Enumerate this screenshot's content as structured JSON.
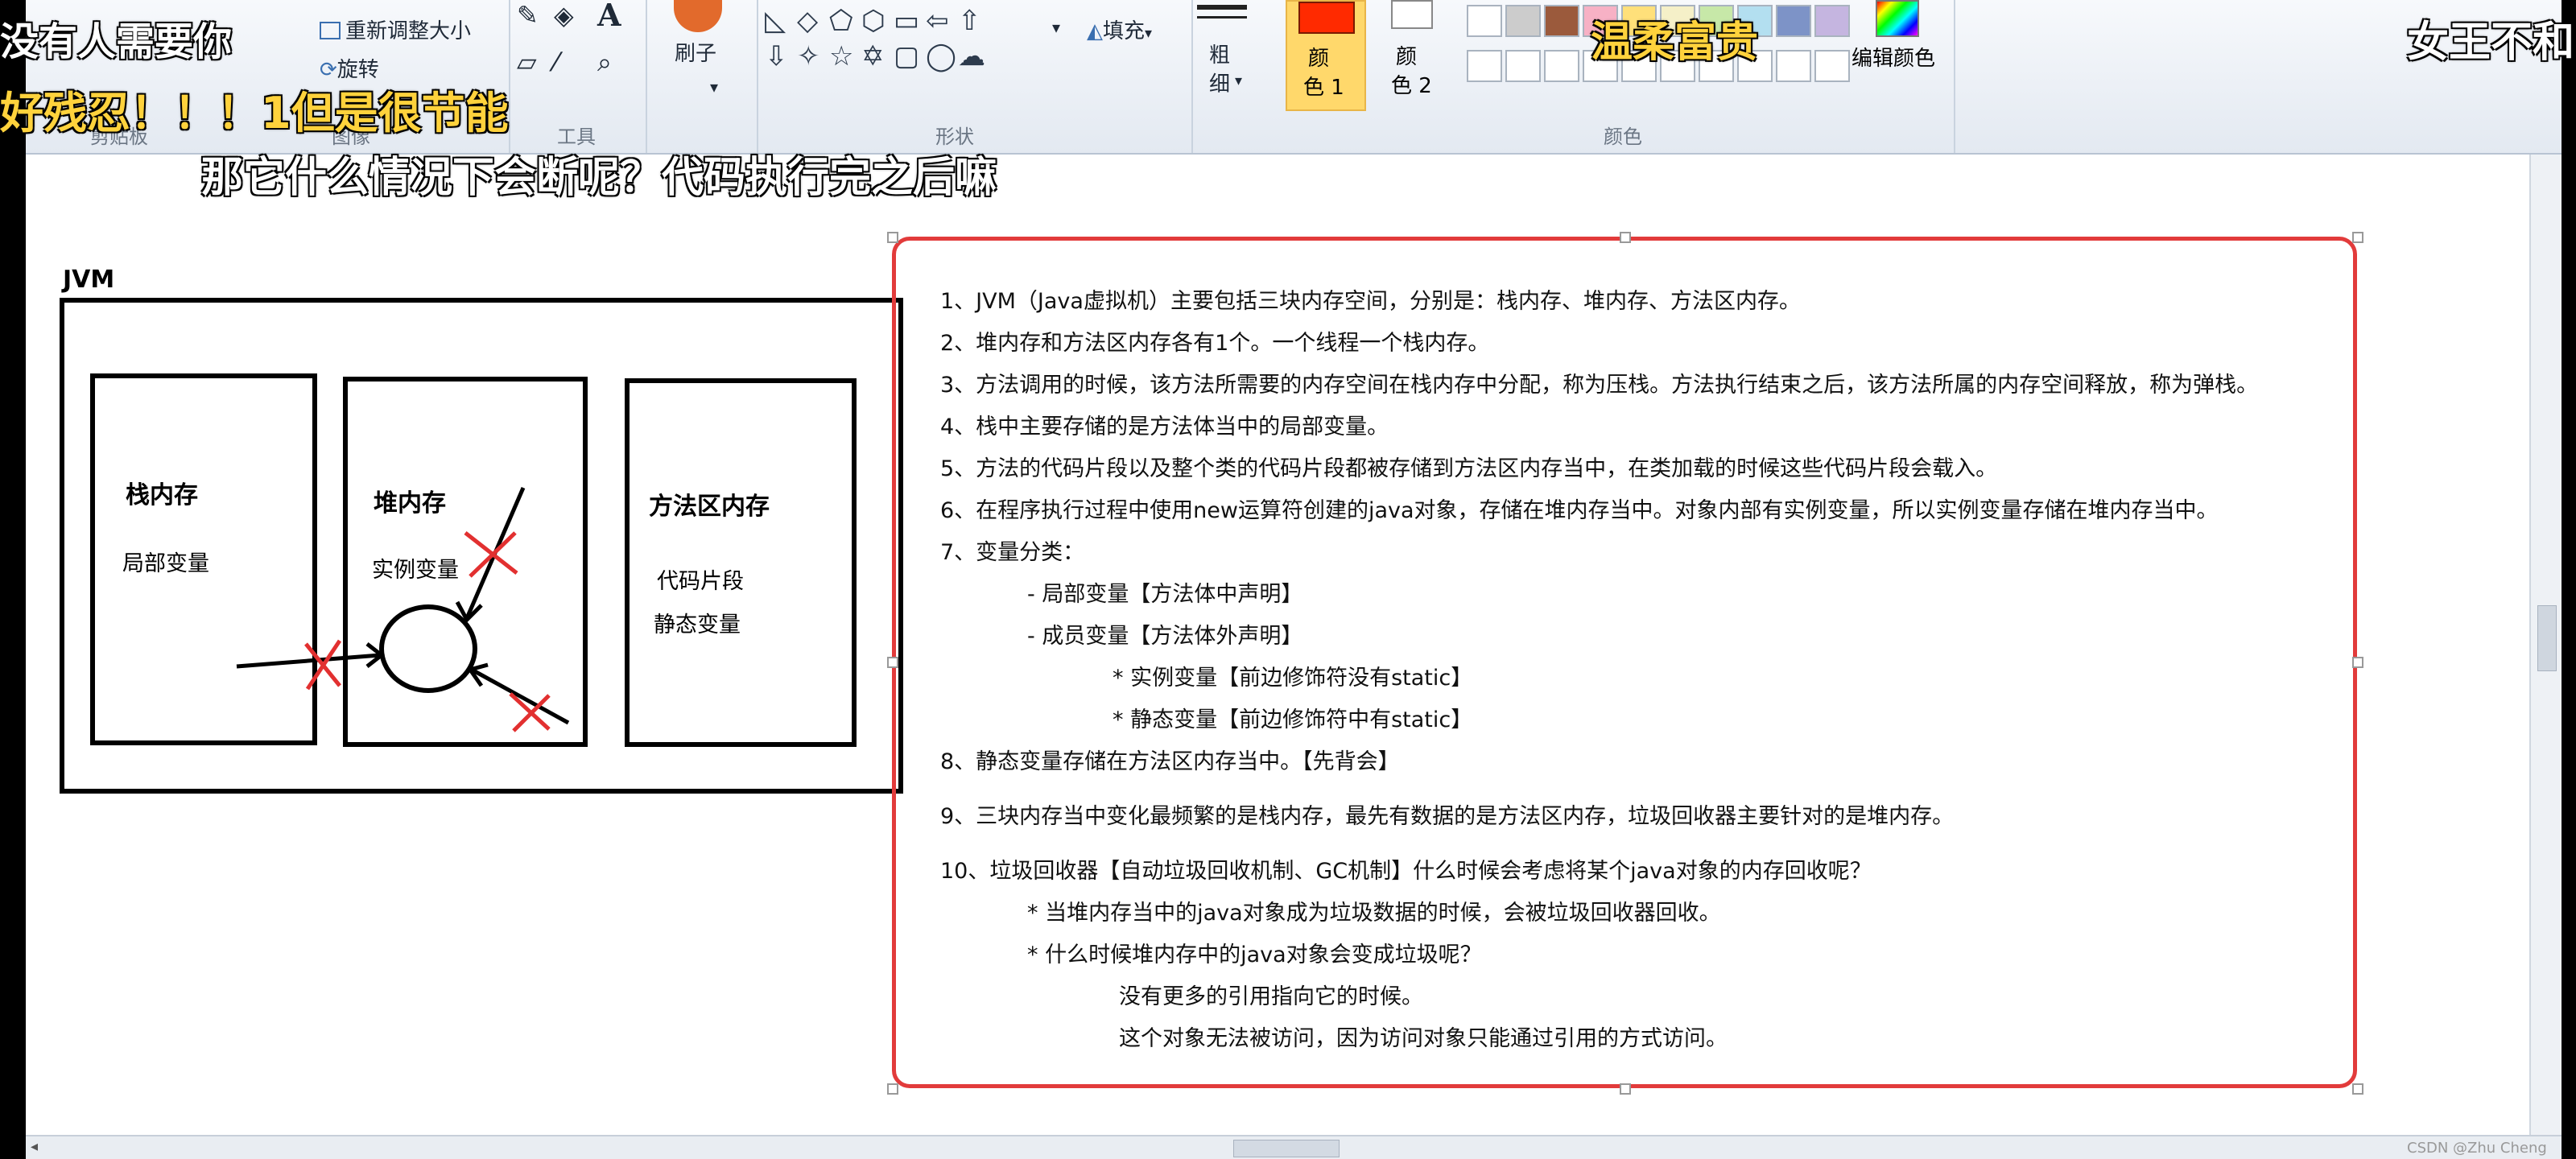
{
  "ribbon": {
    "resize_label": "重新调整大小",
    "rotate_label": "旋转",
    "brush_label": "刷子",
    "fill_label": "填充",
    "size_label_1": "粗",
    "size_label_2": "细",
    "color1_label_1": "颜",
    "color1_label_2": "色 1",
    "color2_label_1": "颜",
    "color2_label_2": "色 2",
    "edit_colors_label": "编辑颜色",
    "group_clipboard": "剪贴板",
    "group_image": "图像",
    "group_tools": "工具",
    "group_shapes": "形状",
    "group_colors": "颜色",
    "text_tool": "A",
    "color1_hex": "#ff2a00",
    "color2_hex": "#ffffff",
    "accent_hex": "#ffd86b"
  },
  "overlay": {
    "line1": "没有人需要你",
    "line2": "好残忍！！！1但是很节能",
    "line3": "那它什么情况下会断呢？代码执行完之后嘛",
    "line4": "温柔富贵",
    "line5": "女王不和"
  },
  "diagram": {
    "jvm_label": "JVM",
    "stack_title": "栈内存",
    "stack_item": "局部变量",
    "heap_title": "堆内存",
    "heap_item": "实例变量",
    "method_title": "方法区内存",
    "method_item1": "代码片段",
    "method_item2": "静态变量"
  },
  "notes": {
    "n1": "1、JVM（Java虚拟机）主要包括三块内存空间，分别是：栈内存、堆内存、方法区内存。",
    "n2": "2、堆内存和方法区内存各有1个。一个线程一个栈内存。",
    "n3": "3、方法调用的时候，该方法所需要的内存空间在栈内存中分配，称为压栈。方法执行结束之后，该方法所属的内存空间释放，称为弹栈。",
    "n4": "4、栈中主要存储的是方法体当中的局部变量。",
    "n5": "5、方法的代码片段以及整个类的代码片段都被存储到方法区内存当中，在类加载的时候这些代码片段会载入。",
    "n6": "6、在程序执行过程中使用new运算符创建的java对象，存储在堆内存当中。对象内部有实例变量，所以实例变量存储在堆内存当中。",
    "n7": "7、变量分类：",
    "n7a": "- 局部变量【方法体中声明】",
    "n7b": "- 成员变量【方法体外声明】",
    "n7b1": "* 实例变量【前边修饰符没有static】",
    "n7b2": "* 静态变量【前边修饰符中有static】",
    "n8": "8、静态变量存储在方法区内存当中。【先背会】",
    "n9": "9、三块内存当中变化最频繁的是栈内存，最先有数据的是方法区内存，垃圾回收器主要针对的是堆内存。",
    "n10": "10、垃圾回收器【自动垃圾回收机制、GC机制】什么时候会考虑将某个java对象的内存回收呢？",
    "n10a": "* 当堆内存当中的java对象成为垃圾数据的时候，会被垃圾回收器回收。",
    "n10b": "* 什么时候堆内存中的java对象会变成垃圾呢？",
    "n10b1": "没有更多的引用指向它的时候。",
    "n10b2": "这个对象无法被访问，因为访问对象只能通过引用的方式访问。"
  },
  "watermark": "CSDN @Zhu Cheng"
}
